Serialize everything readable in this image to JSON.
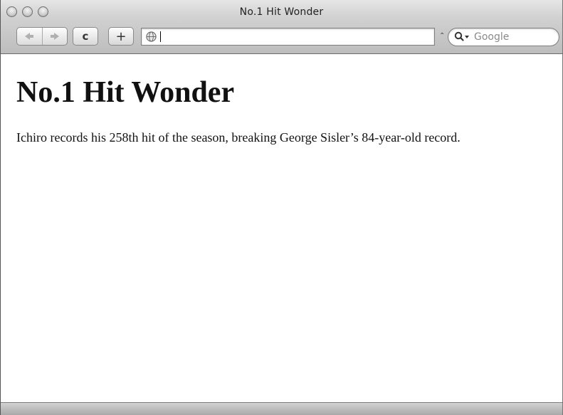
{
  "window": {
    "title": "No.1 Hit Wonder"
  },
  "toolbar": {
    "back_icon": "back-arrow-icon",
    "forward_icon": "forward-arrow-icon",
    "reload_label": "c",
    "add_bookmark_label": "+",
    "address": {
      "value": "",
      "icon": "globe-icon"
    },
    "snapback_label": "⌃",
    "search": {
      "placeholder": "Google",
      "icon": "magnifier-icon"
    }
  },
  "page": {
    "heading": "No.1 Hit Wonder",
    "paragraph": "Ichiro records his 258th hit of the season, breaking George Sisler’s 84-year-old record."
  }
}
